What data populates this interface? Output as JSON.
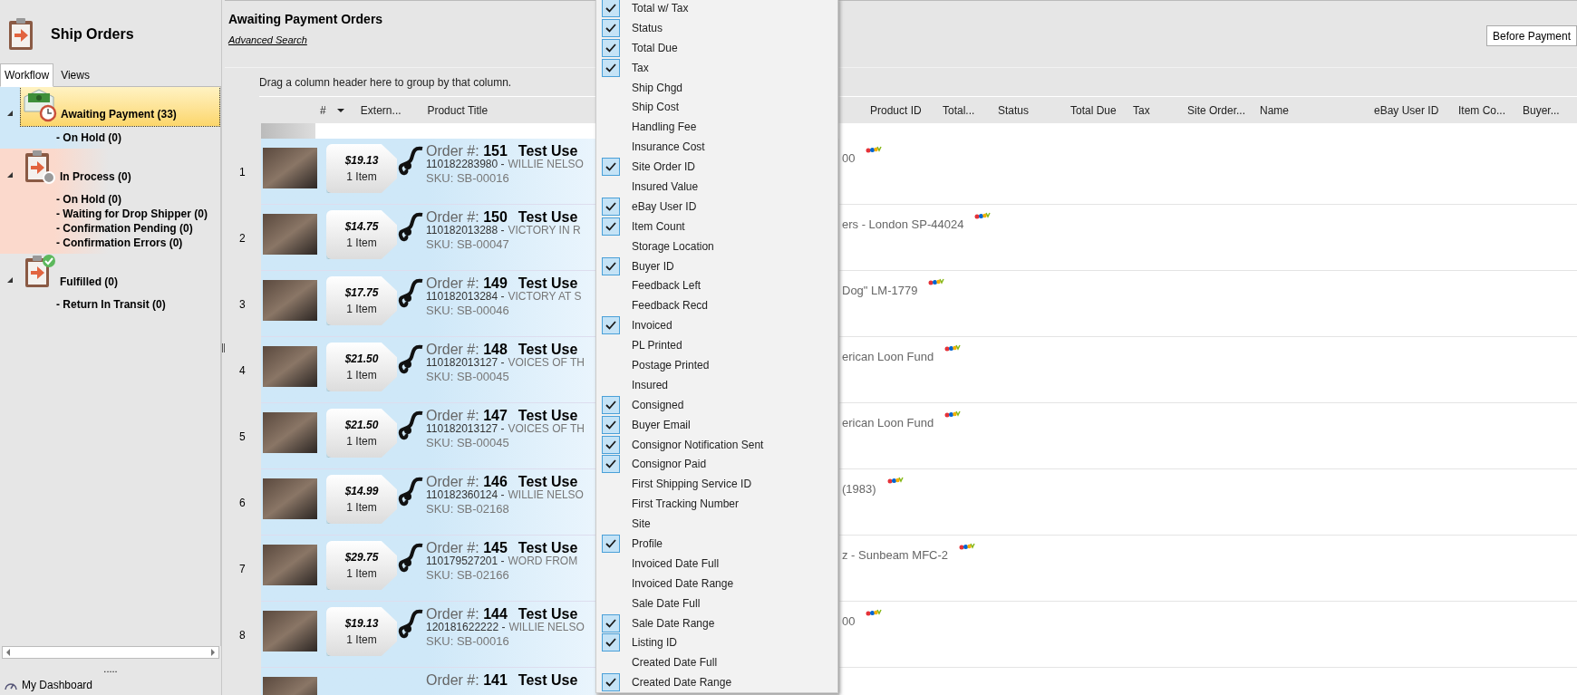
{
  "sidebar": {
    "title": "Ship Orders",
    "tabs": [
      {
        "label": "Workflow",
        "selected": true
      },
      {
        "label": "Views",
        "selected": false
      }
    ],
    "tree": [
      {
        "kind": "awaiting",
        "label": "Awaiting Payment (33)",
        "selected": true,
        "expanded": true,
        "color": "#cfe8f8",
        "children": [
          {
            "label": "- On Hold (0)"
          }
        ]
      },
      {
        "kind": "process",
        "label": "In Process (0)",
        "selected": false,
        "expanded": true,
        "color": "#fbd9cc",
        "children": [
          {
            "label": "- On Hold (0)"
          },
          {
            "label": "- Waiting for Drop Shipper (0)"
          },
          {
            "label": "- Confirmation Pending (0)"
          },
          {
            "label": "- Confirmation Errors (0)"
          }
        ]
      },
      {
        "kind": "fulfilled",
        "label": "Fulfilled (0)",
        "selected": false,
        "expanded": true,
        "children": [
          {
            "label": "- Return In Transit (0)"
          }
        ]
      }
    ],
    "more": ".....",
    "dashboard": "My Dashboard"
  },
  "main": {
    "title": "Awaiting Payment Orders",
    "advanced_search": "Advanced Search",
    "view_select": "Before Payment",
    "group_hint": "Drag a column header here to group by that column.",
    "columns_left": [
      "#",
      "Extern...",
      "Product Title"
    ],
    "columns_right": [
      "Product ID",
      "Total...",
      "Status",
      "Total Due",
      "Tax",
      "Site Order...",
      "Name",
      "eBay User ID",
      "Item Co...",
      "Buyer..."
    ],
    "rows": [
      {
        "number": "1",
        "price": "$19.13",
        "items": "1 Item",
        "order": "Order #: **151**",
        "user": "Test Use",
        "external_id": "110182283980 -",
        "title": "WILLIE NELSO",
        "sku": "SKU: SB-00016",
        "title_end": "00"
      },
      {
        "number": "2",
        "price": "$14.75",
        "items": "1 Item",
        "order": "Order #: **150**",
        "user": "Test Use",
        "external_id": "110182013288 -",
        "title": "VICTORY IN R",
        "sku": "SKU: SB-00047",
        "title_end": "ers - London SP-44024"
      },
      {
        "number": "3",
        "price": "$17.75",
        "items": "1 Item",
        "order": "Order #: **149**",
        "user": "Test Use",
        "external_id": "110182013284 -",
        "title": "VICTORY AT S",
        "sku": "SKU: SB-00046",
        "title_end": "Dog\" LM-1779"
      },
      {
        "number": "4",
        "price": "$21.50",
        "items": "1 Item",
        "order": "Order #: **148**",
        "user": "Test Use",
        "external_id": "110182013127 -",
        "title": "VOICES OF TH",
        "sku": "SKU: SB-00045",
        "title_end": "erican Loon Fund"
      },
      {
        "number": "5",
        "price": "$21.50",
        "items": "1 Item",
        "order": "Order #: **147**",
        "user": "Test Use",
        "external_id": "110182013127 -",
        "title": "VOICES OF TH",
        "sku": "SKU: SB-00045",
        "title_end": "erican Loon Fund"
      },
      {
        "number": "6",
        "price": "$14.99",
        "items": "1 Item",
        "order": "Order #: **146**",
        "user": "Test Use",
        "external_id": "110182360124 -",
        "title": "WILLIE NELSO",
        "sku": "SKU: SB-02168",
        "title_end": "(1983)"
      },
      {
        "number": "7",
        "price": "$29.75",
        "items": "1 Item",
        "order": "Order #: **145**",
        "user": "Test Use",
        "external_id": "110179527201 -",
        "title": "WORD FROM",
        "sku": "SKU: SB-02166",
        "title_end": "z - Sunbeam MFC-2"
      },
      {
        "number": "8",
        "price": "$19.13",
        "items": "1 Item",
        "order": "Order #: **144**",
        "user": "Test Use",
        "external_id": "120181622222 -",
        "title": "WILLIE NELSO",
        "sku": "SKU: SB-00016",
        "title_end": "00"
      },
      {
        "order": "Order #: **141**",
        "user": "Test Use"
      }
    ]
  },
  "column_menu": [
    {
      "label": "Total w/ Tax",
      "checked": true
    },
    {
      "label": "Status",
      "checked": true
    },
    {
      "label": "Total Due",
      "checked": true
    },
    {
      "label": "Tax",
      "checked": true
    },
    {
      "label": "Ship Chgd",
      "checked": false
    },
    {
      "label": "Ship Cost",
      "checked": false
    },
    {
      "label": "Handling Fee",
      "checked": false
    },
    {
      "label": "Insurance Cost",
      "checked": false
    },
    {
      "label": "Site Order ID",
      "checked": true
    },
    {
      "label": "Insured Value",
      "checked": false
    },
    {
      "label": "eBay User ID",
      "checked": true
    },
    {
      "label": "Item Count",
      "checked": true
    },
    {
      "label": "Storage Location",
      "checked": false
    },
    {
      "label": "Buyer ID",
      "checked": true
    },
    {
      "label": "Feedback Left",
      "checked": false
    },
    {
      "label": "Feedback Recd",
      "checked": false
    },
    {
      "label": "Invoiced",
      "checked": true
    },
    {
      "label": "PL Printed",
      "checked": false
    },
    {
      "label": "Postage Printed",
      "checked": false
    },
    {
      "label": "Insured",
      "checked": false
    },
    {
      "label": "Consigned",
      "checked": true
    },
    {
      "label": "Buyer Email",
      "checked": true
    },
    {
      "label": "Consignor Notification Sent",
      "checked": true
    },
    {
      "label": "Consignor Paid",
      "checked": true
    },
    {
      "label": "First Shipping Service ID",
      "checked": false
    },
    {
      "label": "First Tracking Number",
      "checked": false
    },
    {
      "label": "Site",
      "checked": false
    },
    {
      "label": "Profile",
      "checked": true
    },
    {
      "label": "Invoiced Date Full",
      "checked": false
    },
    {
      "label": "Invoiced Date Range",
      "checked": false
    },
    {
      "label": "Sale Date Full",
      "checked": false
    },
    {
      "label": "Sale Date Range",
      "checked": true
    },
    {
      "label": "Listing ID",
      "checked": true
    },
    {
      "label": "Created Date Full",
      "checked": false
    },
    {
      "label": "Created Date Range",
      "checked": true
    }
  ]
}
